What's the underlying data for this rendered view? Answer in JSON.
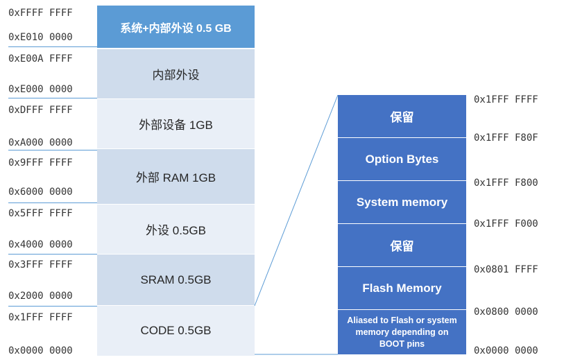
{
  "left_map": {
    "blocks": [
      {
        "label": "系统+内部外设 0.5 GB",
        "top_addr": "0xFFFF FFFF",
        "bottom_addr": "0xE010 0000",
        "fill": "#5b9bd5",
        "text_color": "#ffffff"
      },
      {
        "label": "内部外设",
        "top_addr": "0xE00A FFFF",
        "bottom_addr": "0xE000 0000",
        "fill": "#cfdcec",
        "text_color": "#262626"
      },
      {
        "label": "外部设备 1GB",
        "top_addr": "0xDFFF FFFF",
        "bottom_addr": "0xA000 0000",
        "fill": "#e9eff7",
        "text_color": "#262626"
      },
      {
        "label": "外部 RAM 1GB",
        "top_addr": "0x9FFF FFFF",
        "bottom_addr": "0x6000 0000",
        "fill": "#cfdcec",
        "text_color": "#262626"
      },
      {
        "label": "外设 0.5GB",
        "top_addr": "0x5FFF FFFF",
        "bottom_addr": "0x4000 0000",
        "fill": "#e9eff7",
        "text_color": "#262626"
      },
      {
        "label": "SRAM 0.5GB",
        "top_addr": "0x3FFF FFFF",
        "bottom_addr": "0x2000 0000",
        "fill": "#cfdcec",
        "text_color": "#262626"
      },
      {
        "label": "CODE 0.5GB",
        "top_addr": "0x1FFF FFFF",
        "bottom_addr": "0x0000 0000",
        "fill": "#e9eff7",
        "text_color": "#262626"
      }
    ]
  },
  "right_map": {
    "blocks": [
      {
        "label": "保留"
      },
      {
        "label": "Option Bytes"
      },
      {
        "label": "System memory"
      },
      {
        "label": "保留"
      },
      {
        "label": "Flash Memory"
      },
      {
        "label": "Aliased to Flash or system memory depending on BOOT pins"
      }
    ],
    "addresses": [
      "0x1FFF FFFF",
      "0x1FFF F80F",
      "0x1FFF F800",
      "0x1FFF F000",
      "0x0801 FFFF",
      "0x0800 0000",
      "0x0000 0000"
    ],
    "fill": "#4472c4"
  },
  "colors": {
    "connector": "#5b9bd5",
    "separator": "#5b9bd5"
  }
}
